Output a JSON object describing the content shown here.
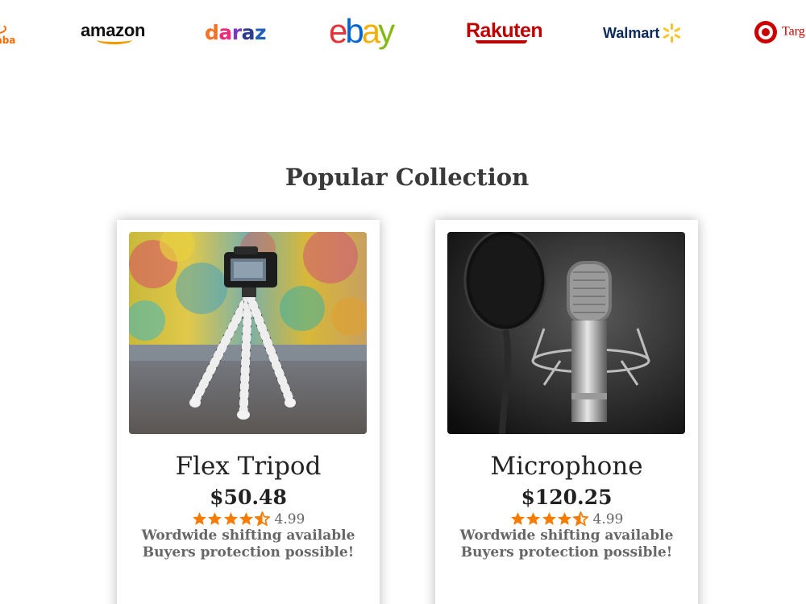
{
  "brands": {
    "alibaba": "baba",
    "amazon": "amazon",
    "daraz": [
      "d",
      "a",
      "r",
      "a",
      "z"
    ],
    "ebay": [
      "e",
      "b",
      "a",
      "y"
    ],
    "rakuten": "Rakuten",
    "walmart": "Walmart",
    "target": "Targ"
  },
  "section": {
    "title": "Popular Collection"
  },
  "products": [
    {
      "name": "Flex Tripod",
      "price": "$50.48",
      "rating": "4.99",
      "stars": 4.5,
      "shipping": "Wordwide shifting available",
      "protection": "Buyers protection possible!"
    },
    {
      "name": "Microphone",
      "price": "$120.25",
      "rating": "4.99",
      "stars": 4.5,
      "shipping": "Wordwide shifting available",
      "protection": "Buyers protection possible!"
    }
  ],
  "colors": {
    "star": "#f57c00",
    "card_text_muted": "#666666",
    "title": "#3a3a3a"
  },
  "icons": {
    "star": "star-icon",
    "half_star": "half-star-icon"
  }
}
